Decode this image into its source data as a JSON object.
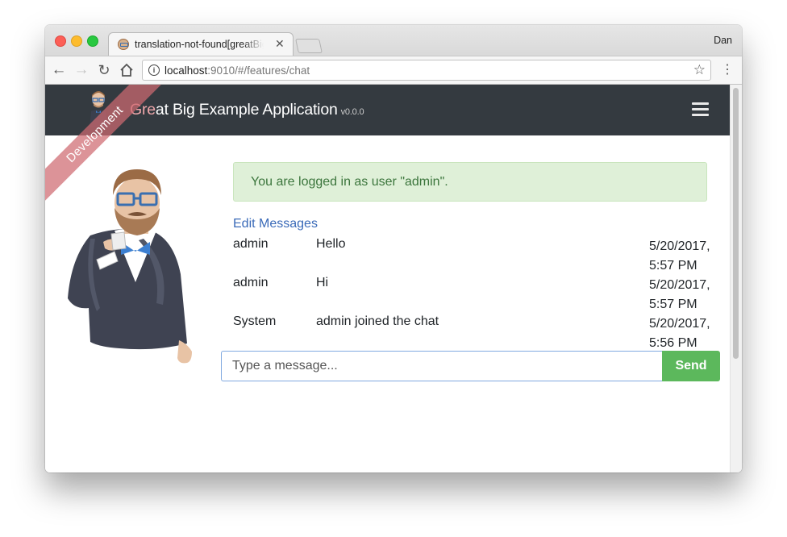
{
  "browser": {
    "tab_title": "translation-not-found[greatBigExampleApplication]",
    "profile_name": "Dan",
    "url_host": "localhost",
    "url_rest": ":9010/#/features/chat",
    "icons": {
      "back": "arrow-left-icon",
      "forward": "arrow-right-icon",
      "reload": "reload-icon",
      "home": "home-icon",
      "info": "info-icon",
      "bookmark": "star-icon",
      "menu": "vertical-dots-icon"
    }
  },
  "app": {
    "ribbon_label": "Development",
    "brand_title": "Great Big Example Application",
    "brand_version": "v0.0.0",
    "navbar_color": "#343a40",
    "ribbon_color": "#ce6a70"
  },
  "chat": {
    "alert_text": "You are logged in as user \"admin\".",
    "edit_link": "Edit Messages",
    "messages": [
      {
        "user": "admin",
        "text": "Hello",
        "time": "5/20/2017, 5:57 PM"
      },
      {
        "user": "admin",
        "text": "Hi",
        "time": "5/20/2017, 5:57 PM"
      },
      {
        "user": "System",
        "text": "admin joined the chat",
        "time": "5/20/2017, 5:56 PM"
      }
    ],
    "input_placeholder": "Type a message...",
    "send_label": "Send",
    "send_color": "#5cb85c",
    "alert_color": "#dff0d8"
  }
}
